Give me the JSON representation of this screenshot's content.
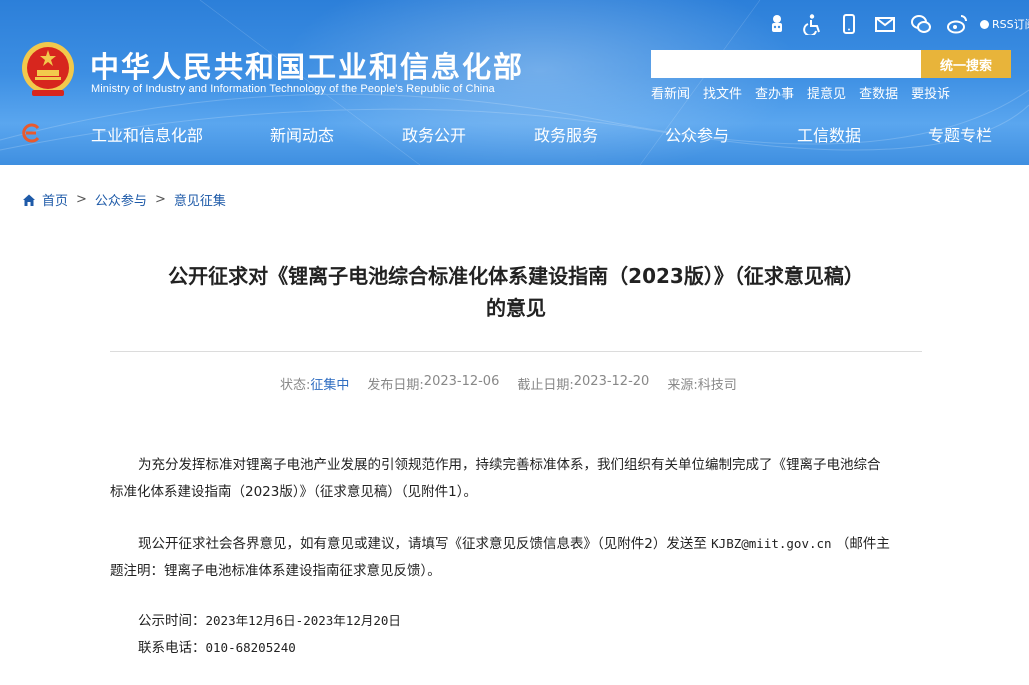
{
  "header": {
    "site_title": "中华人民共和国工业和信息化部",
    "site_subtitle": "Ministry of Industry and Information Technology of the People's Republic of China",
    "rss_label": "RSS订阅",
    "search": {
      "placeholder": "",
      "button_label": "统一搜索"
    },
    "quick_links": [
      "看新闻",
      "找文件",
      "查办事",
      "提意见",
      "查数据",
      "要投诉"
    ],
    "tools": [
      "robot-icon",
      "accessibility-icon",
      "mobile-icon",
      "mail-icon",
      "wechat-icon",
      "weibo-icon"
    ]
  },
  "nav": {
    "items": [
      "工业和信息化部",
      "新闻动态",
      "政务公开",
      "政务服务",
      "公众参与",
      "工信数据",
      "专题专栏"
    ]
  },
  "breadcrumb": [
    "首页",
    "公众参与",
    "意见征集"
  ],
  "article": {
    "title_line1": "公开征求对《锂离子电池综合标准化体系建设指南（2023版）》（征求意见稿）",
    "title_line2": "的意见",
    "meta": {
      "status_label": "状态:",
      "status_value": "征集中",
      "publish_label": "发布日期:",
      "publish_value": "2023-12-06",
      "deadline_label": "截止日期:",
      "deadline_value": "2023-12-20",
      "source_label": "来源:",
      "source_value": "科技司"
    },
    "p1_line1": "为充分发挥标准对锂离子电池产业发展的引领规范作用，持续完善标准体系，我们组织有关单位编制完成了《锂离子电池综合",
    "p1_line2": "标准化体系建设指南（2023版）》（征求意见稿）（见附件1）。",
    "p2_line1_a": "现公开征求社会各界意见，如有意见或建议，请填写《征求意见反馈信息表》（见附件2）发送至 ",
    "p2_email": "KJBZ@miit.gov.cn",
    "p2_line1_b": " （邮件主",
    "p2_line2": "题注明：锂离子电池标准体系建设指南征求意见反馈）。",
    "time_label": "公示时间：",
    "time_value": "2023年12月6日-2023年12月20日",
    "phone_label": "联系电话：",
    "phone_value": "010-68205240"
  },
  "colors": {
    "header_blue": "#2c7fd9",
    "search_button": "#e8b43a",
    "link_blue": "#1e5aa8",
    "status_blue": "#2f6dc1"
  }
}
